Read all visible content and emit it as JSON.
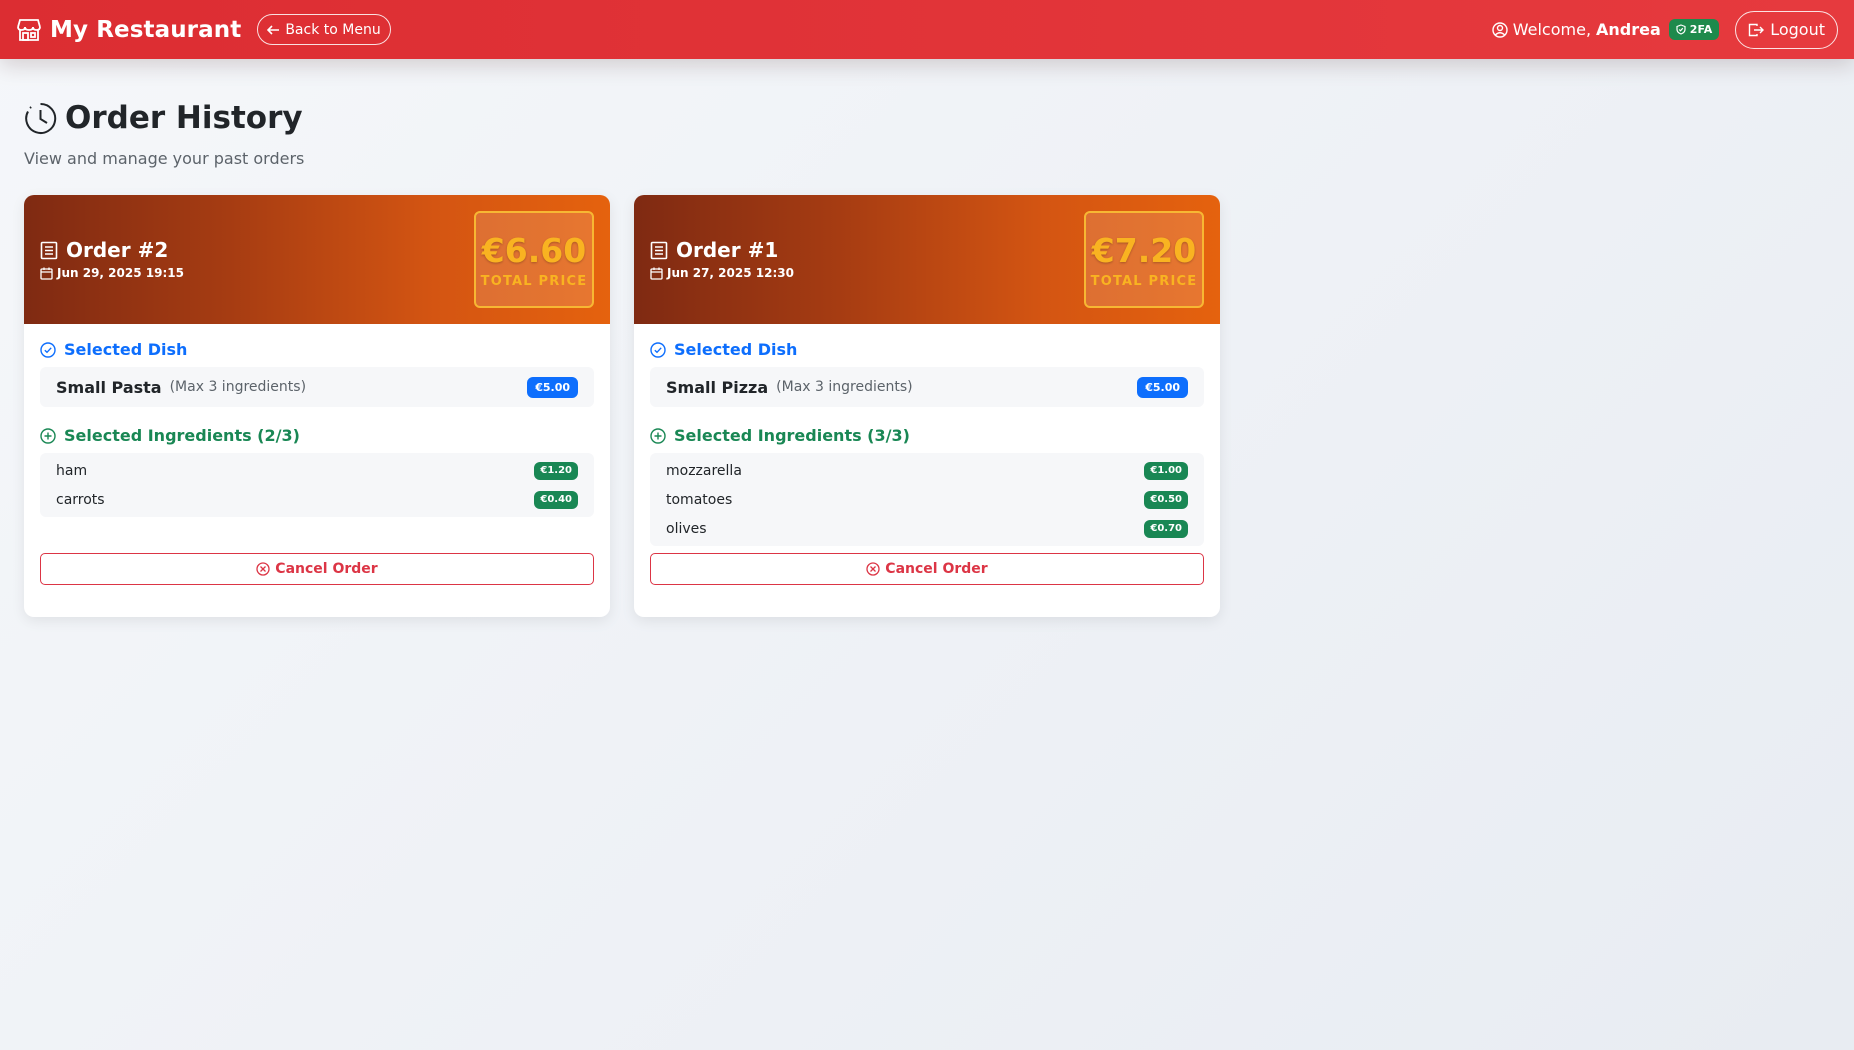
{
  "navbar": {
    "brand": "My Restaurant",
    "back_label": "Back to Menu",
    "welcome_prefix": "Welcome,",
    "user_name": "Andrea",
    "twofa_label": "2FA",
    "logout_label": "Logout"
  },
  "page": {
    "title": "Order History",
    "subtitle": "View and manage your past orders"
  },
  "orders": [
    {
      "title": "Order #2",
      "date": "Jun 29, 2025 19:15",
      "total": "€6.60",
      "total_label": "TOTAL PRICE",
      "dish_section_label": "Selected Dish",
      "dish_name": "Small Pasta",
      "dish_limit": "(Max 3 ingredients)",
      "dish_price": "€5.00",
      "ingredients_section_label": "Selected Ingredients (2/3)",
      "ingredients": [
        {
          "name": "ham",
          "price": "€1.20"
        },
        {
          "name": "carrots",
          "price": "€0.40"
        }
      ],
      "cancel_label": "Cancel Order"
    },
    {
      "title": "Order #1",
      "date": "Jun 27, 2025 12:30",
      "total": "€7.20",
      "total_label": "TOTAL PRICE",
      "dish_section_label": "Selected Dish",
      "dish_name": "Small Pizza",
      "dish_limit": "(Max 3 ingredients)",
      "dish_price": "€5.00",
      "ingredients_section_label": "Selected Ingredients (3/3)",
      "ingredients": [
        {
          "name": "mozzarella",
          "price": "€1.00"
        },
        {
          "name": "tomatoes",
          "price": "€0.50"
        },
        {
          "name": "olives",
          "price": "€0.70"
        }
      ],
      "cancel_label": "Cancel Order"
    }
  ],
  "colors": {
    "navbar": "#dc2d32",
    "accent_gold": "#f9b321",
    "dish_badge": "#0d6efd",
    "ingredient_badge": "#198754",
    "cancel": "#dc3545"
  }
}
